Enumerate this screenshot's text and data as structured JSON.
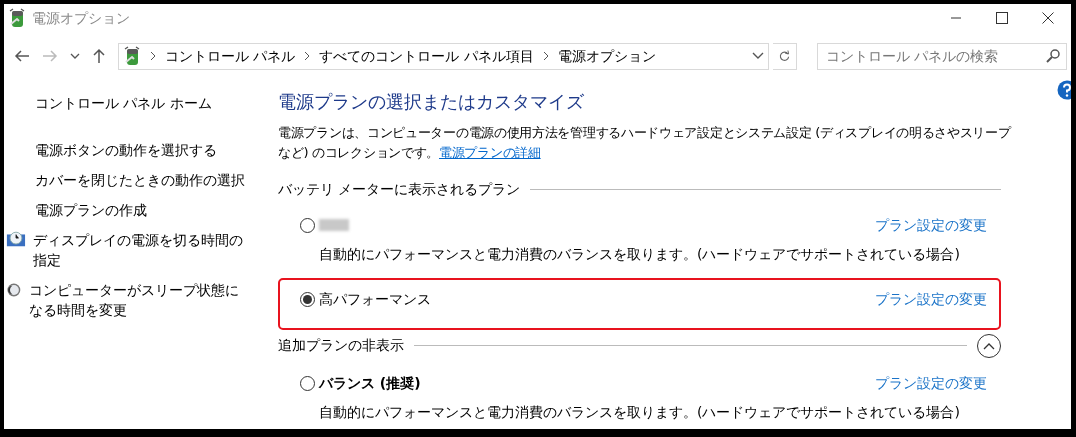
{
  "window": {
    "title": "電源オプション"
  },
  "nav": {
    "breadcrumb": [
      "コントロール パネル",
      "すべてのコントロール パネル項目",
      "電源オプション"
    ],
    "search": {
      "placeholder": "コントロール パネルの検索"
    }
  },
  "sidebar": {
    "home": "コントロール パネル ホーム",
    "items": [
      {
        "label": "電源ボタンの動作を選択する",
        "kind": "plain"
      },
      {
        "label": "カバーを閉じたときの動作の選択",
        "kind": "plain"
      },
      {
        "label": "電源プランの作成",
        "kind": "plain"
      },
      {
        "label": "ディスプレイの電源を切る時間の指定",
        "kind": "display"
      },
      {
        "label": "コンピューターがスリープ状態になる時間を変更",
        "kind": "sleep"
      }
    ]
  },
  "main": {
    "heading": "電源プランの選択またはカスタマイズ",
    "description": "電源プランは、コンピューターの電源の使用方法を管理するハードウェア設定とシステム設定 (ディスプレイの明るさやスリープなど) のコレクションです。",
    "description_link": "電源プランの詳細",
    "sections": [
      {
        "title": "バッテリ メーターに表示されるプラン",
        "plans": [
          {
            "kind": "redacted",
            "selected": false,
            "highlighted": false,
            "link": "プラン設定の変更",
            "description": "自動的にパフォーマンスと電力消費のバランスを取ります。(ハードウェアでサポートされている場合)"
          },
          {
            "kind": "named",
            "name": "高パフォーマンス",
            "selected": true,
            "highlighted": true,
            "recommended": false,
            "link": "プラン設定の変更"
          }
        ]
      },
      {
        "title": "追加プランの非表示",
        "toggle": {
          "expanded": true
        },
        "plans": [
          {
            "kind": "named",
            "name": "バランス (推奨)",
            "selected": false,
            "highlighted": false,
            "recommended": true,
            "link": "プラン設定の変更",
            "description": "自動的にパフォーマンスと電力消費のバランスを取ります。(ハードウェアでサポートされている場合)"
          }
        ]
      }
    ]
  }
}
